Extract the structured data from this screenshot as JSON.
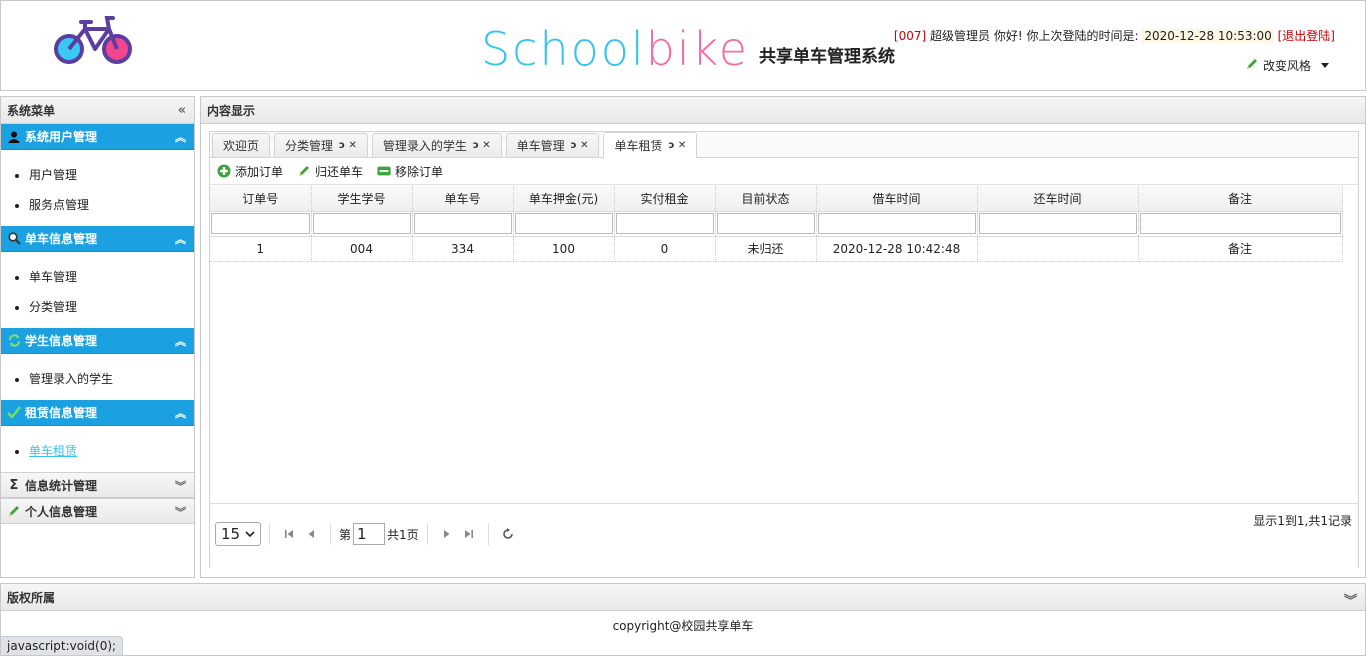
{
  "header": {
    "brand_school": "School",
    "brand_bike": "bike",
    "brand_sub": "共享单车管理系统",
    "user_id": "[007]",
    "user_greeting": "超级管理员 你好! 你上次登陆的时间是:",
    "last_login": "2020-12-28 10:53:00",
    "logout": "[退出登陆]",
    "change_style": "改变风格"
  },
  "sidebar": {
    "title": "系统菜单",
    "sections": [
      {
        "label": "系统用户管理",
        "icon": "user-icon",
        "items": [
          "用户管理",
          "服务点管理"
        ]
      },
      {
        "label": "单车信息管理",
        "icon": "search-icon",
        "items": [
          "单车管理",
          "分类管理"
        ]
      },
      {
        "label": "学生信息管理",
        "icon": "refresh-icon",
        "items": [
          "管理录入的学生"
        ]
      },
      {
        "label": "租赁信息管理",
        "icon": "check-icon",
        "items": [
          "单车租赁"
        ]
      },
      {
        "label": "信息统计管理",
        "icon": "sigma-icon"
      },
      {
        "label": "个人信息管理",
        "icon": "pencil-icon"
      }
    ]
  },
  "content": {
    "title": "内容显示",
    "tabs": [
      "欢迎页",
      "分类管理",
      "管理录入的学生",
      "单车管理",
      "单车租赁"
    ],
    "toolbar": {
      "add": "添加订单",
      "return": "归还单车",
      "remove": "移除订单"
    },
    "columns": [
      "订单号",
      "学生学号",
      "单车号",
      "单车押金(元)",
      "实付租金",
      "目前状态",
      "借车时间",
      "还车时间",
      "备注"
    ],
    "rows": [
      [
        "1",
        "004",
        "334",
        "100",
        "0",
        "未归还",
        "2020-12-28 10:42:48",
        "",
        "备注"
      ]
    ],
    "pager": {
      "page_size": "15",
      "page_prefix": "第",
      "page_number": "1",
      "page_suffix": "共1页",
      "info": "显示1到1,共1记录"
    }
  },
  "footer": {
    "title": "版权所属",
    "copyright": "copyright@校园共享单车"
  },
  "statusbar": "javascript:void(0);",
  "colors": {
    "accent": "#1ba0e1",
    "brand_blue": "#35c4f0",
    "brand_pink": "#f36ea0",
    "alert": "#e02020"
  }
}
